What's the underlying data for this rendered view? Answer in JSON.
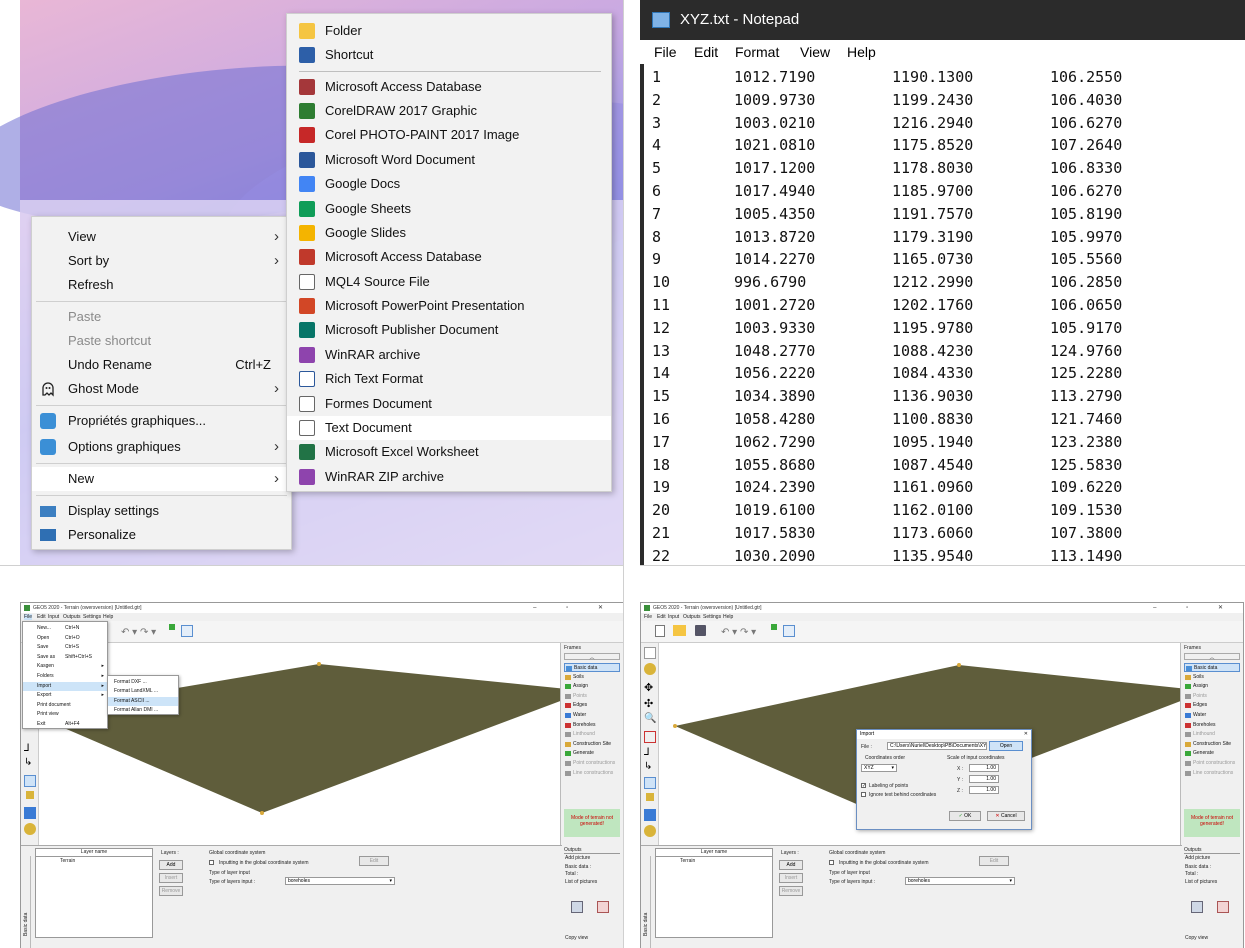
{
  "context_menu": {
    "items": [
      {
        "label": "View",
        "arrow": true
      },
      {
        "label": "Sort by",
        "arrow": true
      },
      {
        "label": "Refresh"
      },
      {
        "label": "Paste",
        "disabled": true
      },
      {
        "label": "Paste shortcut",
        "disabled": true
      },
      {
        "label": "Undo Rename",
        "shortcut": "Ctrl+Z"
      },
      {
        "label": "Ghost Mode",
        "arrow": true
      },
      {
        "label": "Propriétés graphiques..."
      },
      {
        "label": "Options graphiques",
        "arrow": true
      },
      {
        "label": "New",
        "arrow": true
      },
      {
        "label": "Display settings"
      },
      {
        "label": "Personalize"
      }
    ]
  },
  "new_submenu": {
    "items": [
      {
        "label": "Folder",
        "icon": "folder-icon",
        "color": "#f5c542"
      },
      {
        "label": "Shortcut",
        "icon": "shortcut-icon",
        "color": "#2d5fa8"
      },
      {
        "label": "Microsoft Access Database",
        "icon": "access-icon",
        "color": "#a4373a"
      },
      {
        "label": "CorelDRAW 2017 Graphic",
        "icon": "coreldraw-icon",
        "color": "#2e7d32"
      },
      {
        "label": "Corel PHOTO-PAINT 2017 Image",
        "icon": "photopaint-icon",
        "color": "#c62828"
      },
      {
        "label": "Microsoft Word Document",
        "icon": "word-icon",
        "color": "#2b579a"
      },
      {
        "label": "Google Docs",
        "icon": "google-docs-icon",
        "color": "#4285f4"
      },
      {
        "label": "Google Sheets",
        "icon": "google-sheets-icon",
        "color": "#0f9d58"
      },
      {
        "label": "Google Slides",
        "icon": "google-slides-icon",
        "color": "#f4b400"
      },
      {
        "label": "Microsoft Access Database",
        "icon": "access-icon",
        "color": "#c0392b"
      },
      {
        "label": "MQL4 Source File",
        "icon": "file-icon",
        "color": "#ffffff"
      },
      {
        "label": "Microsoft PowerPoint Presentation",
        "icon": "powerpoint-icon",
        "color": "#d24726"
      },
      {
        "label": "Microsoft Publisher Document",
        "icon": "publisher-icon",
        "color": "#077568"
      },
      {
        "label": "WinRAR archive",
        "icon": "winrar-icon",
        "color": "#8e44ad"
      },
      {
        "label": "Rich Text Format",
        "icon": "rtf-icon",
        "color": "#2b579a"
      },
      {
        "label": "Formes Document",
        "icon": "file-icon",
        "color": "#ffffff"
      },
      {
        "label": "Text Document",
        "icon": "text-document-icon",
        "color": "#ffffff"
      },
      {
        "label": "Microsoft Excel Worksheet",
        "icon": "excel-icon",
        "color": "#217346"
      },
      {
        "label": "WinRAR ZIP archive",
        "icon": "winrar-zip-icon",
        "color": "#8e44ad"
      }
    ]
  },
  "notepad": {
    "title": "XYZ.txt - Notepad",
    "menu": [
      "File",
      "Edit",
      "Format",
      "View",
      "Help"
    ],
    "rows": [
      [
        "1",
        "1012.7190",
        "1190.1300",
        "106.2550"
      ],
      [
        "2",
        "1009.9730",
        "1199.2430",
        "106.4030"
      ],
      [
        "3",
        "1003.0210",
        "1216.2940",
        "106.6270"
      ],
      [
        "4",
        "1021.0810",
        "1175.8520",
        "107.2640"
      ],
      [
        "5",
        "1017.1200",
        "1178.8030",
        "106.8330"
      ],
      [
        "6",
        "1017.4940",
        "1185.9700",
        "106.6270"
      ],
      [
        "7",
        "1005.4350",
        "1191.7570",
        "105.8190"
      ],
      [
        "8",
        "1013.8720",
        "1179.3190",
        "105.9970"
      ],
      [
        "9",
        "1014.2270",
        "1165.0730",
        "105.5560"
      ],
      [
        "10",
        "996.6790",
        "1212.2990",
        "106.2850"
      ],
      [
        "11",
        "1001.2720",
        "1202.1760",
        "106.0650"
      ],
      [
        "12",
        "1003.9330",
        "1195.9780",
        "105.9170"
      ],
      [
        "13",
        "1048.2770",
        "1088.4230",
        "124.9760"
      ],
      [
        "14",
        "1056.2220",
        "1084.4330",
        "125.2280"
      ],
      [
        "15",
        "1034.3890",
        "1136.9030",
        "113.2790"
      ],
      [
        "16",
        "1058.4280",
        "1100.8830",
        "121.7460"
      ],
      [
        "17",
        "1062.7290",
        "1095.1940",
        "123.2380"
      ],
      [
        "18",
        "1055.8680",
        "1087.4540",
        "125.5830"
      ],
      [
        "19",
        "1024.2390",
        "1161.0960",
        "109.6220"
      ],
      [
        "20",
        "1019.6100",
        "1162.0100",
        "109.1530"
      ],
      [
        "21",
        "1017.5830",
        "1173.6060",
        "107.3800"
      ],
      [
        "22",
        "1030.2090",
        "1135.9540",
        "113.1490"
      ]
    ]
  },
  "geo": {
    "title": "GEO5 2020 - Terrain (owersversion) [Untitled.gtr]",
    "window_controls": "– ▫ ✕",
    "menu": [
      "File",
      "Edit",
      "Input",
      "Outputs",
      "Settings",
      "Help"
    ],
    "file_menu": [
      {
        "label": "New...",
        "shortcut": "Ctrl+N"
      },
      {
        "label": "Open",
        "shortcut": "Ctrl+O"
      },
      {
        "label": "Save",
        "shortcut": "Ctrl+S"
      },
      {
        "label": "Save as",
        "shortcut": "Shift+Ctrl+S"
      },
      {
        "label": "Kasgen",
        "arrow": true
      },
      {
        "label": "Folders",
        "arrow": true
      },
      {
        "label": "Import",
        "arrow": true
      },
      {
        "label": "Export",
        "arrow": true
      },
      {
        "label": "Print document"
      },
      {
        "label": "Print view"
      },
      {
        "label": "Exit",
        "shortcut": "Alt+F4"
      }
    ],
    "import_menu": [
      "Format DXF ...",
      "Format LandXML ...",
      "Format ASCII ...",
      "Format Allan DMI ..."
    ],
    "frames_title": "Frames",
    "frames": [
      {
        "label": "Basic data",
        "selected": true
      },
      {
        "label": "Soils"
      },
      {
        "label": "Assign"
      },
      {
        "label": "Points",
        "dim": true
      },
      {
        "label": "Edges"
      },
      {
        "label": "Water"
      },
      {
        "label": "Boreholes"
      },
      {
        "label": "Linthound",
        "dim": true
      },
      {
        "label": "Construction Site"
      },
      {
        "label": "Generate"
      },
      {
        "label": "Point constructions",
        "dim": true
      },
      {
        "label": "Line constructions",
        "dim": true
      }
    ],
    "mode_text": "Mode of terrain not generated!",
    "outputs_title": "Outputs",
    "outputs": [
      "Add picture",
      "Basic data :",
      "Total :",
      "List of pictures",
      "Copy view"
    ],
    "layer_header": "Layer name",
    "layer_row": "Terrain",
    "layers_label": "Layers :",
    "buttons": [
      "Add",
      "Insert",
      "Remove"
    ],
    "global_cs": "Global coordinate system",
    "global_cs_check": "Inputting in the global coordinate system",
    "edit_btn": "Edit",
    "type_layer": "Type of layer input",
    "type_layer_label": "Type of layers input :",
    "type_layer_value": "boreholes",
    "side_tab": "Basic data",
    "import_dialog": {
      "title": "Import",
      "file_label": "File :",
      "file_path": "C:\\Users\\Nuriel\\Desktop\\PB\\Documents\\XYZ.txt",
      "open": "Open",
      "coord_order": "Coordinates order",
      "coord_value": "XYZ",
      "scale_label": "Scale of input coordinates",
      "x_label": "X :",
      "y_label": "Y :",
      "z_label": "Z :",
      "x": "1.00",
      "y": "1.00",
      "z": "1.00",
      "labeling": "Labeling of points",
      "ignore": "Ignore text behind coordinates",
      "ok": "OK",
      "cancel": "Cancel"
    }
  }
}
